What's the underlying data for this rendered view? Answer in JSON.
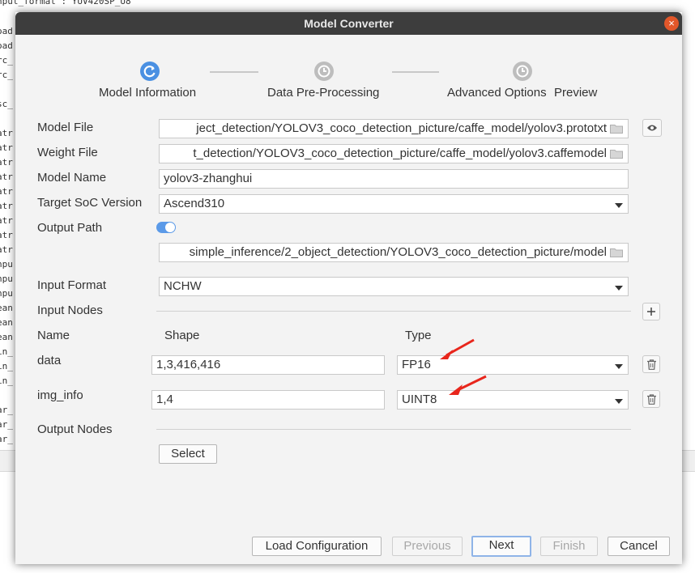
{
  "background_terminal": {
    "first_line": "nput_format : YUV420SP_U8",
    "lines": [
      "oad",
      "oad",
      "rc_",
      "rc_",
      "",
      "sc_",
      "",
      "atr",
      "atr",
      "atr",
      "atr",
      "atr",
      "atr",
      "atr",
      "atr",
      "atr",
      "npu",
      "npu",
      "npu",
      "ean",
      "ean",
      "ean",
      "in_",
      "in_",
      "in_",
      "",
      "ar_",
      "ar_",
      "ar_"
    ]
  },
  "dialog": {
    "title": "Model Converter",
    "close_glyph": "×",
    "steps": [
      {
        "label": "Model Information",
        "state": "active"
      },
      {
        "label": "Data Pre-Processing",
        "state": "pending"
      },
      {
        "label": "Advanced Options",
        "state": "pending"
      },
      {
        "label": "Preview",
        "state": "pending"
      }
    ],
    "form": {
      "model_file": {
        "label": "Model File",
        "value": "ject_detection/YOLOV3_coco_detection_picture/caffe_model/yolov3.prototxt"
      },
      "weight_file": {
        "label": "Weight File",
        "value": "t_detection/YOLOV3_coco_detection_picture/caffe_model/yolov3.caffemodel"
      },
      "model_name": {
        "label": "Model Name",
        "value": "yolov3-zhanghui"
      },
      "target_soc": {
        "label": "Target SoC Version",
        "value": "Ascend310"
      },
      "output_path": {
        "label": "Output Path",
        "toggle_on": true,
        "value": "simple_inference/2_object_detection/YOLOV3_coco_detection_picture/model"
      },
      "input_format": {
        "label": "Input Format",
        "value": "NCHW"
      },
      "input_nodes": {
        "label": "Input Nodes",
        "headers": {
          "name": "Name",
          "shape": "Shape",
          "type": "Type"
        },
        "rows": [
          {
            "name": "data",
            "shape": "1,3,416,416",
            "type": "FP16"
          },
          {
            "name": "img_info",
            "shape": "1,4",
            "type": "UINT8"
          }
        ]
      },
      "output_nodes": {
        "label": "Output Nodes",
        "select_label": "Select"
      }
    },
    "footer": {
      "load_configuration": "Load Configuration",
      "previous": "Previous",
      "next": "Next",
      "finish": "Finish",
      "cancel": "Cancel"
    },
    "colors": {
      "accent": "#4a90e2",
      "annotation_arrow": "#e8261c",
      "titlebar": "#3d3d3d",
      "close": "#e2572a"
    }
  }
}
